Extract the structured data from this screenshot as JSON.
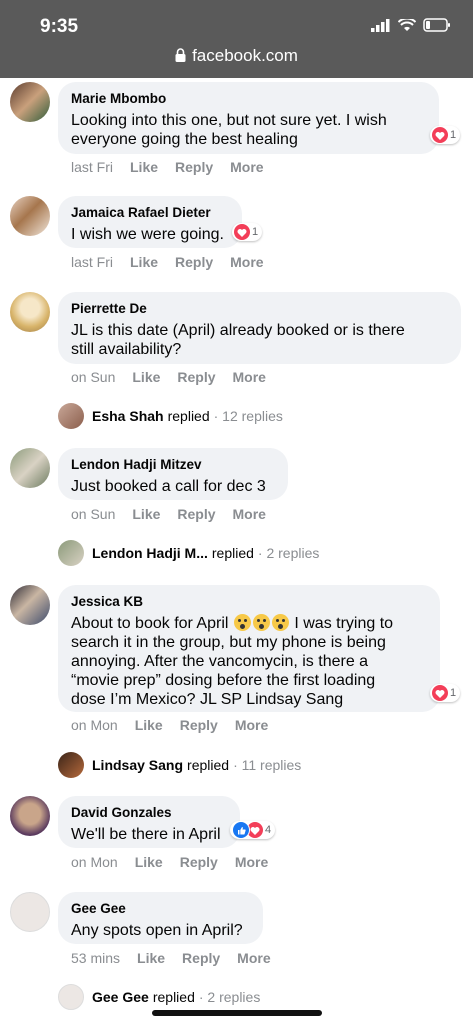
{
  "status_bar": {
    "time": "9:35",
    "url": "facebook.com"
  },
  "comments": [
    {
      "author": "Marie Mbombo",
      "lines": [
        "Looking into this one, but not sure yet. I wish",
        "everyone going the best healing"
      ],
      "time": "last Fri",
      "like": "Like",
      "reply": "Reply",
      "more": "More",
      "reactions": "1"
    },
    {
      "author": "Jamaica Rafael Dieter",
      "lines": [
        "I wish we were going."
      ],
      "time": "last Fri",
      "like": "Like",
      "reply": "Reply",
      "more": "More",
      "reactions": "1"
    },
    {
      "author": "Pierrette De",
      "lines": [
        "JL is this date (April) already booked or is there",
        "still availability?"
      ],
      "time": "on Sun",
      "like": "Like",
      "reply": "Reply",
      "more": "More"
    },
    {
      "author": "Lendon Hadji Mitzev",
      "lines": [
        "Just booked a call for dec 3"
      ],
      "time": "on Sun",
      "like": "Like",
      "reply": "Reply",
      "more": "More"
    },
    {
      "author": "Jessica KB",
      "line1_pre": "About to book for April",
      "line1_post": "I was trying to",
      "lines": [
        "search it in the group, but my phone is being",
        "annoying. After the vancomycin, is there a",
        "“movie prep” dosing before the first loading",
        "dose I’m Mexico? JL SP Lindsay Sang"
      ],
      "time": "on Mon",
      "like": "Like",
      "reply": "Reply",
      "more": "More",
      "reactions": "1"
    },
    {
      "author": "David Gonzales",
      "lines": [
        "We'll be there in April"
      ],
      "time": "on Mon",
      "like": "Like",
      "reply": "Reply",
      "more": "More",
      "reactions": "4"
    },
    {
      "author": "Gee Gee",
      "lines": [
        "Any spots open in April?"
      ],
      "time": "53 mins",
      "like": "Like",
      "reply": "Reply",
      "more": "More"
    }
  ],
  "reply_threads": [
    {
      "name": "Esha Shah",
      "verb": "replied",
      "count": "· 12 replies"
    },
    {
      "name": "Lendon Hadji M...",
      "verb": "replied",
      "count": "· 2 replies"
    },
    {
      "name": "Lindsay Sang",
      "verb": "replied",
      "count": "· 11 replies"
    },
    {
      "name": "Gee Gee",
      "verb": "replied",
      "count": "· 2 replies"
    }
  ],
  "colors": {
    "status_bg": "#5a5a5a",
    "bubble_bg": "#f0f2f5",
    "heart": "#f33e58",
    "like_blue": "#1877f2",
    "meta_gray": "#8a8d91"
  },
  "icons": [
    "lock-icon",
    "signal-icon",
    "wifi-icon",
    "battery-icon",
    "heart-reaction-icon",
    "like-reaction-icon",
    "scream-emoji-icon"
  ]
}
